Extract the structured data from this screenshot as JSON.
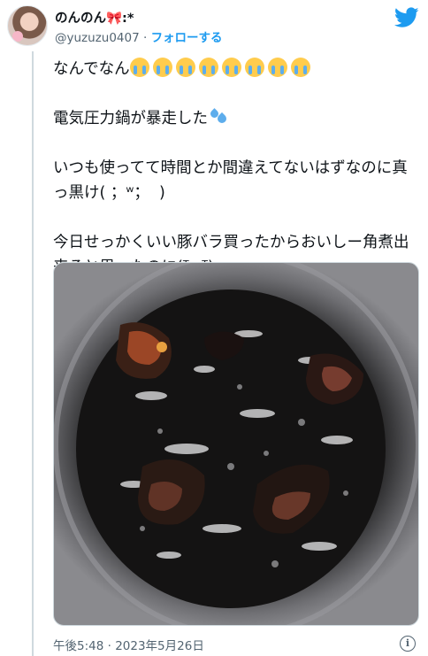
{
  "author": {
    "display_name": "のんのん🎀:*",
    "handle": "@yuzuzu0407",
    "separator": " · ",
    "follow_label": "フォローする"
  },
  "tweet": {
    "line1_text": "なんでなん",
    "line1_emoji": "loudly-crying-face",
    "line1_emoji_count": 8,
    "line2_text": "電気圧力鍋が暴走した",
    "line2_emoji": "sweat-droplets",
    "para3": "いつも使ってて時間とか間違えてないはずなのに真っ黒け( ；ʷ；  )",
    "para4": "今日せっかくいい豚バラ買ったからおいしー角煮出来ると思ったのに(ᵀωᵀ)"
  },
  "photo": {
    "description_icon": "burnt-pot-photo"
  },
  "footer": {
    "timestamp": "午後5:48 · 2023年5月26日",
    "info_icon": "info-icon"
  },
  "colors": {
    "accent": "#1d9bf0",
    "text": "#0f1419",
    "muted": "#536471",
    "border": "#cfd9de"
  }
}
